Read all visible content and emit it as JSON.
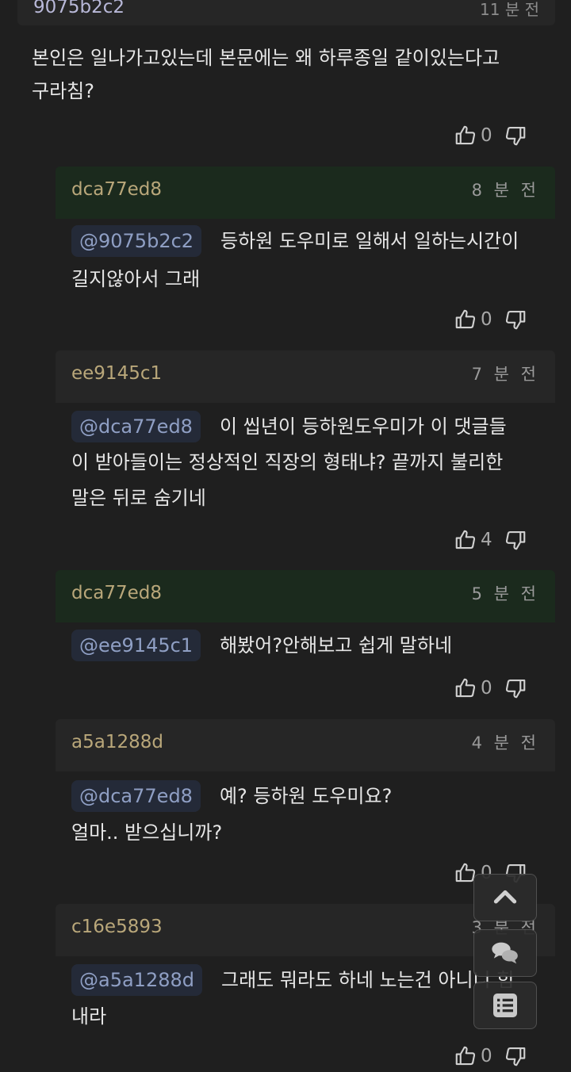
{
  "top_comment": {
    "user": "9075b2c2",
    "time": "11 분 전",
    "text_line1": "본인은 일나가고있는데 본문에는 왜 하루종일 같이있는다고",
    "text_line2": "구라침?",
    "likes": "0"
  },
  "replies": [
    {
      "user": "dca77ed8",
      "time": "8 분 전",
      "mention": "@9075b2c2",
      "line1": "등하원 도우미로 일해서 일하는시간이",
      "line2": "길지않아서 그래",
      "line3": "",
      "likes": "0"
    },
    {
      "user": "ee9145c1",
      "time": "7 분 전",
      "mention": "@dca77ed8",
      "line1": "이 씹년이 등하원도우미가 이 댓글들",
      "line2": "이 받아들이는 정상적인 직장의 형태냐? 끝까지 불리한",
      "line3": "말은 뒤로 숨기네",
      "likes": "4"
    },
    {
      "user": "dca77ed8",
      "time": "5 분 전",
      "mention": "@ee9145c1",
      "line1": "해봤어?안해보고 쉽게 말하네",
      "line2": "",
      "line3": "",
      "likes": "0"
    },
    {
      "user": "a5a1288d",
      "time": "4 분 전",
      "mention": "@dca77ed8",
      "line1": "예? 등하원 도우미요?",
      "line2": "얼마.. 받으십니까?",
      "line3": "",
      "likes": "0"
    },
    {
      "user": "c16e5893",
      "time": "3 분 전",
      "mention": "@a5a1288d",
      "line1": "그래도 뭐라도 하네 노는건 아니니 힘",
      "line2": "내라",
      "line3": "",
      "likes": "0"
    }
  ],
  "icons": {
    "like": "thumbs-up-icon",
    "dislike": "thumbs-down-icon",
    "scroll_top": "chevron-up-icon",
    "comments": "chat-bubbles-icon",
    "list": "list-icon"
  },
  "colors": {
    "background": "#1f1f1f",
    "username": "#b9a77a",
    "mention_bg": "#242a38",
    "mention_text": "#8f9fc4",
    "highlight_header": "#1b2a1d"
  }
}
